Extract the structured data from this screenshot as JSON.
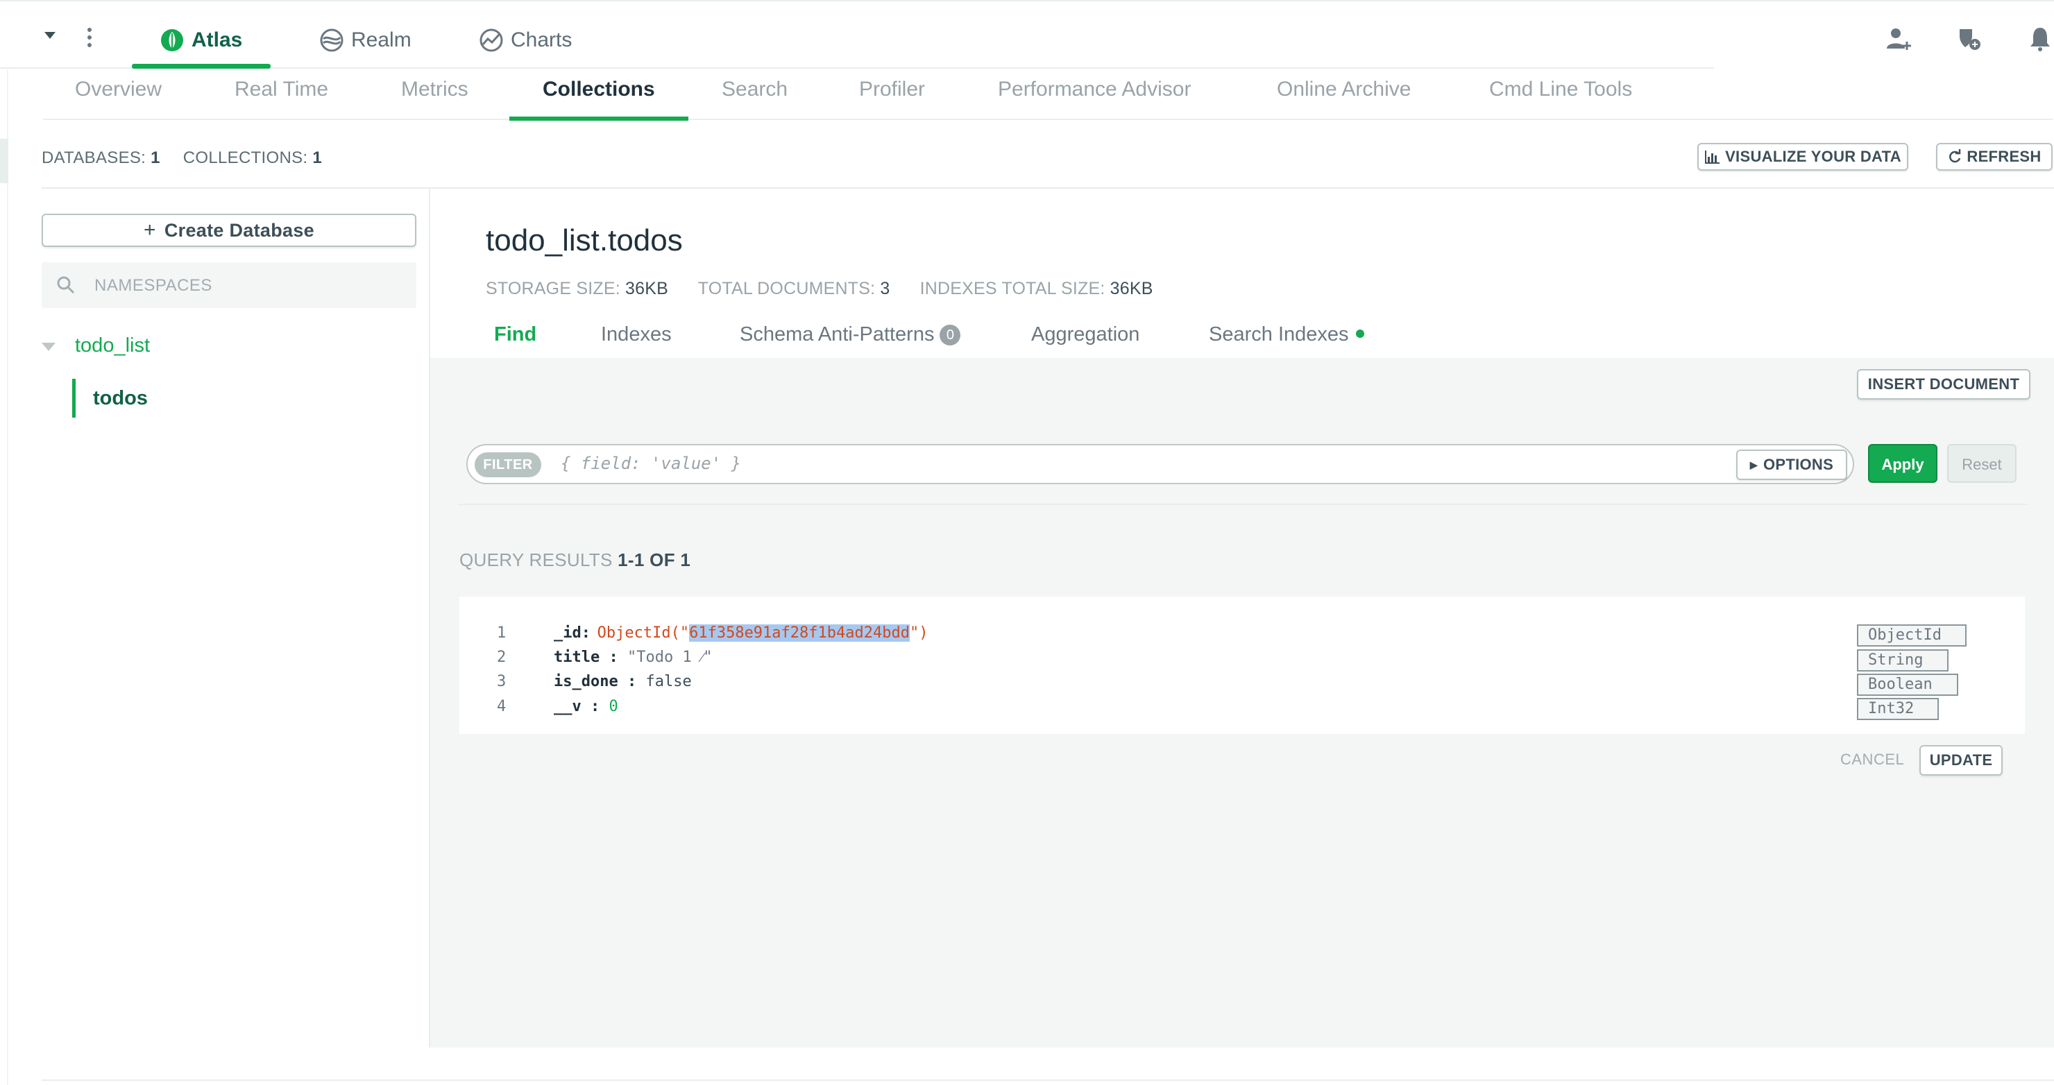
{
  "product_tabs": {
    "atlas": "Atlas",
    "realm": "Realm",
    "charts": "Charts"
  },
  "subnav": {
    "items": [
      "Overview",
      "Real Time",
      "Metrics",
      "Collections",
      "Search",
      "Profiler",
      "Performance Advisor",
      "Online Archive",
      "Cmd Line Tools"
    ],
    "active": "Collections"
  },
  "counts": {
    "databases_label": "DATABASES:",
    "databases_value": "1",
    "collections_label": "COLLECTIONS:",
    "collections_value": "1"
  },
  "toolbar": {
    "visualize_label": "VISUALIZE YOUR DATA",
    "refresh_label": "REFRESH"
  },
  "sidebar": {
    "create_db_label": "Create Database",
    "namespaces_placeholder": "NAMESPACES",
    "database": "todo_list",
    "collection": "todos"
  },
  "collection": {
    "title": "todo_list.todos",
    "storage_label": "STORAGE SIZE:",
    "storage_value": "36KB",
    "docs_label": "TOTAL DOCUMENTS:",
    "docs_value": "3",
    "indexes_label": "INDEXES TOTAL SIZE:",
    "indexes_value": "36KB"
  },
  "collection_tabs": {
    "find": "Find",
    "indexes": "Indexes",
    "schema": "Schema Anti-Patterns",
    "schema_badge": "0",
    "aggregation": "Aggregation",
    "search_indexes": "Search Indexes"
  },
  "find": {
    "insert_label": "INSERT DOCUMENT",
    "filter_pill": "FILTER",
    "filter_placeholder": "{ field: 'value' }",
    "options_label": "OPTIONS",
    "apply_label": "Apply",
    "reset_label": "Reset",
    "results_label": "QUERY RESULTS",
    "results_range": "1-1 OF 1"
  },
  "document": {
    "lines": [
      {
        "num": "1",
        "key": "_id",
        "prefix": "ObjectId(\"",
        "value": "61f358e91af28f1b4ad24bdd",
        "suffix": "\")",
        "type": "ObjectId"
      },
      {
        "num": "2",
        "key": "title",
        "value": "\"Todo 1 ",
        "suffix": "\"",
        "type": "String"
      },
      {
        "num": "3",
        "key": "is_done",
        "value": "false",
        "type": "Boolean"
      },
      {
        "num": "4",
        "key": "__v",
        "value": "0",
        "type": "Int32"
      }
    ],
    "cancel_label": "CANCEL",
    "update_label": "UPDATE"
  },
  "colors": {
    "accent": "#13aa52",
    "dark_green": "#116149",
    "objectid": "#cf4a1e",
    "selection": "#a6c8f0"
  }
}
